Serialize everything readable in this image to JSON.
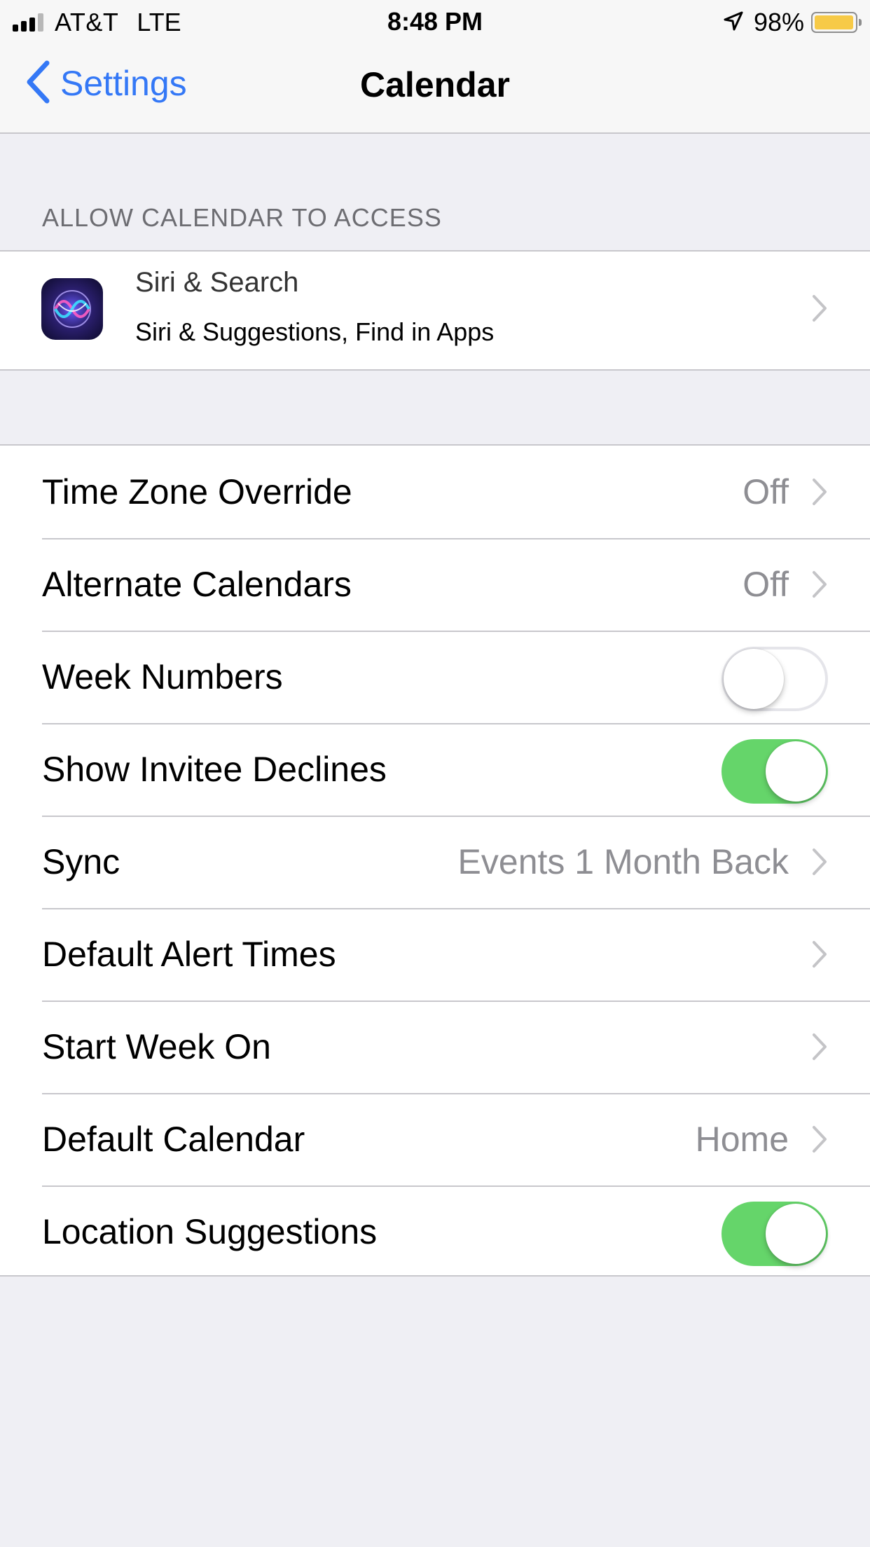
{
  "status_bar": {
    "carrier": "AT&T",
    "network": "LTE",
    "time": "8:48 PM",
    "battery_percent": "98%",
    "battery_level": 0.98,
    "signal_bars": 3,
    "signal_max": 4,
    "battery_color": "#f7ca47",
    "location_icon": "location-arrow-icon"
  },
  "nav": {
    "back_label": "Settings",
    "title": "Calendar"
  },
  "section_access": {
    "header": "ALLOW CALENDAR TO ACCESS",
    "siri": {
      "title": "Siri & Search",
      "subtitle": "Siri & Suggestions, Find in Apps",
      "icon": "siri-icon"
    }
  },
  "settings": {
    "time_zone_override": {
      "label": "Time Zone Override",
      "value": "Off"
    },
    "alternate_calendars": {
      "label": "Alternate Calendars",
      "value": "Off"
    },
    "week_numbers": {
      "label": "Week Numbers",
      "on": false
    },
    "show_invitee_declines": {
      "label": "Show Invitee Declines",
      "on": true
    },
    "sync": {
      "label": "Sync",
      "value": "Events 1 Month Back"
    },
    "default_alert_times": {
      "label": "Default Alert Times"
    },
    "start_week_on": {
      "label": "Start Week On"
    },
    "default_calendar": {
      "label": "Default Calendar",
      "value": "Home"
    },
    "location_suggestions": {
      "label": "Location Suggestions",
      "on": true
    }
  },
  "colors": {
    "accent": "#3478f6",
    "toggle_on": "#65d56a",
    "background": "#efeff4",
    "secondary_text": "#8e8e93"
  }
}
